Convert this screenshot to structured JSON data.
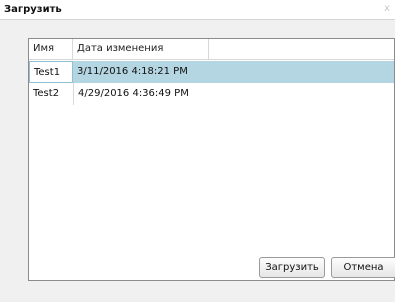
{
  "dialog": {
    "title": "Загрузить",
    "close_symbol": "x"
  },
  "grid": {
    "columns": [
      "Имя",
      "Дата изменения"
    ],
    "rows": [
      {
        "name": "Test1",
        "modified": "3/11/2016 4:18:21 PM",
        "selected": true
      },
      {
        "name": "Test2",
        "modified": "4/29/2016 4:36:49 PM",
        "selected": false
      }
    ]
  },
  "buttons": {
    "load_label": "Загрузить",
    "cancel_label": "Отмена"
  },
  "colors": {
    "selected_row": "#b4d5e2",
    "dialog_background": "#f0f0f0"
  }
}
